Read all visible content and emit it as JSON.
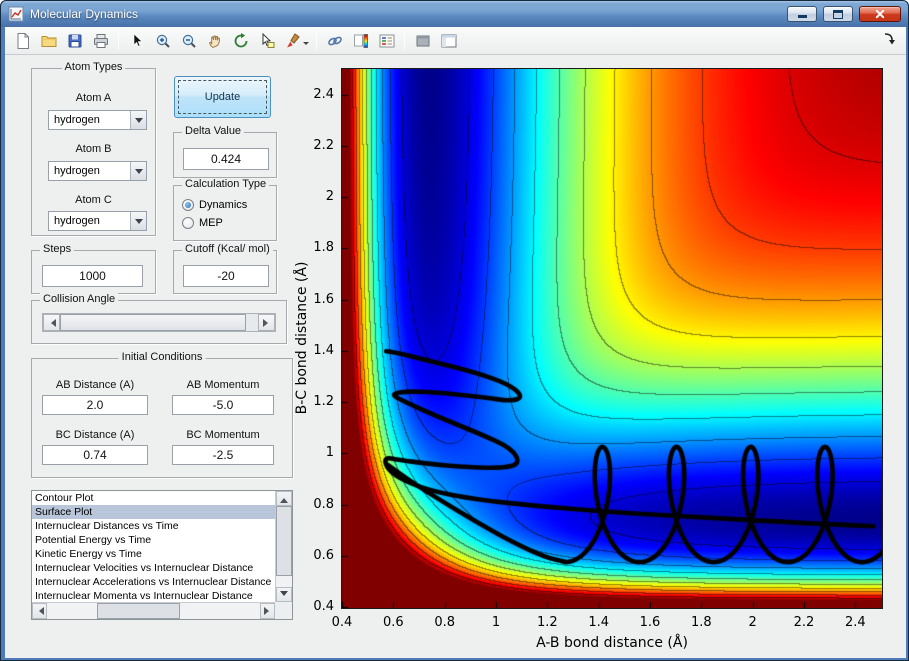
{
  "window": {
    "title": "Molecular Dynamics",
    "control_icons": [
      "minimize-icon",
      "maximize-icon",
      "close-icon"
    ]
  },
  "toolbar": {
    "icon_names": [
      "new-figure",
      "open-file",
      "save-figure",
      "print-figure",
      "pointer",
      "zoom-in",
      "zoom-out",
      "pan",
      "rotate-3d",
      "data-cursor",
      "brush",
      "link-plot",
      "insert-colorbar",
      "insert-legend",
      "hide-plot-tools",
      "show-plot-tools-dock",
      "dock-figure-arrow"
    ]
  },
  "panel": {
    "atom_types": {
      "title": "Atom Types",
      "fields": [
        {
          "label": "Atom A",
          "value": "hydrogen"
        },
        {
          "label": "Atom B",
          "value": "hydrogen"
        },
        {
          "label": "Atom C",
          "value": "hydrogen"
        }
      ]
    },
    "update_button": "Update",
    "delta": {
      "title": "Delta Value",
      "value": "0.424"
    },
    "calculation": {
      "title": "Calculation Type",
      "options": [
        {
          "label": "Dynamics",
          "selected": true
        },
        {
          "label": "MEP",
          "selected": false
        }
      ]
    },
    "steps": {
      "title": "Steps",
      "value": "1000"
    },
    "cutoff": {
      "title": "Cutoff (Kcal/ mol)",
      "value": "-20"
    },
    "collision": {
      "title": "Collision Angle"
    },
    "initial": {
      "title": "Initial Conditions",
      "fields": [
        {
          "label": "AB Distance (A)",
          "value": "2.0"
        },
        {
          "label": "AB Momentum",
          "value": "-5.0"
        },
        {
          "label": "BC Distance (A)",
          "value": "0.74"
        },
        {
          "label": "BC Momentum",
          "value": "-2.5"
        }
      ]
    },
    "plot_list": {
      "items": [
        "Contour Plot",
        "Surface Plot",
        "Internuclear Distances vs Time",
        "Potential Energy vs Time",
        "Kinetic Energy vs Time",
        "Internuclear Velocities vs Internuclear Distance",
        "Internuclear Accelerations vs Internuclear Distance",
        "Internuclear Momenta vs Internuclear Distance"
      ],
      "selected_index": 1
    }
  },
  "chart_data": {
    "type": "heatmap",
    "title": "",
    "xlabel": "A-B bond distance (Å)",
    "ylabel": "B-C bond distance (Å)",
    "x_range": [
      0.4,
      2.5
    ],
    "y_range": [
      0.4,
      2.5
    ],
    "x_ticks": [
      0.4,
      0.6,
      0.8,
      1,
      1.2,
      1.4,
      1.6,
      1.8,
      2,
      2.2,
      2.4
    ],
    "y_ticks": [
      0.4,
      0.6,
      0.8,
      1,
      1.2,
      1.4,
      1.6,
      1.8,
      2,
      2.2,
      2.4
    ],
    "colormap": "jet",
    "grid": false,
    "surface": {
      "model": "LEPS",
      "D": 109.5,
      "alpha": 2.2,
      "r0": 0.742,
      "v_min": -110,
      "v_max": 0,
      "contour_interval": 10
    },
    "trajectory": {
      "color": "#000000",
      "line_width": 4.6,
      "strokes": [
        [
          [
            2.47,
            0.715
          ],
          [
            2.15,
            0.73
          ],
          [
            1.8,
            0.75
          ],
          [
            1.45,
            0.77
          ],
          [
            1.15,
            0.795
          ],
          [
            0.92,
            0.82
          ],
          [
            0.76,
            0.85
          ],
          [
            0.645,
            0.89
          ],
          [
            0.578,
            0.935
          ],
          [
            0.563,
            0.985
          ],
          [
            0.62,
            0.975
          ],
          [
            0.74,
            0.958
          ],
          [
            0.9,
            0.945
          ],
          [
            1.03,
            0.942
          ],
          [
            1.095,
            0.96
          ],
          [
            1.06,
            1.02
          ],
          [
            0.94,
            1.075
          ],
          [
            0.78,
            1.14
          ],
          [
            0.635,
            1.205
          ],
          [
            0.589,
            1.232
          ],
          [
            0.66,
            1.243
          ],
          [
            0.8,
            1.235
          ],
          [
            0.95,
            1.218
          ],
          [
            1.065,
            1.203
          ],
          [
            1.105,
            1.222
          ],
          [
            1.05,
            1.27
          ],
          [
            0.92,
            1.315
          ],
          [
            0.76,
            1.356
          ],
          [
            0.615,
            1.392
          ],
          [
            0.572,
            1.398
          ]
        ],
        [
          [
            0.578,
            0.955
          ],
          [
            0.66,
            0.895
          ],
          [
            0.77,
            0.825
          ],
          [
            0.91,
            0.74
          ],
          [
            1.06,
            0.655
          ],
          [
            1.19,
            0.595
          ]
        ]
      ],
      "loops": {
        "x0": 1.27,
        "speed": 0.046,
        "wobble": 0.09,
        "y_center": 0.8,
        "y_amp": 0.225,
        "t_end": 26.5
      }
    }
  }
}
